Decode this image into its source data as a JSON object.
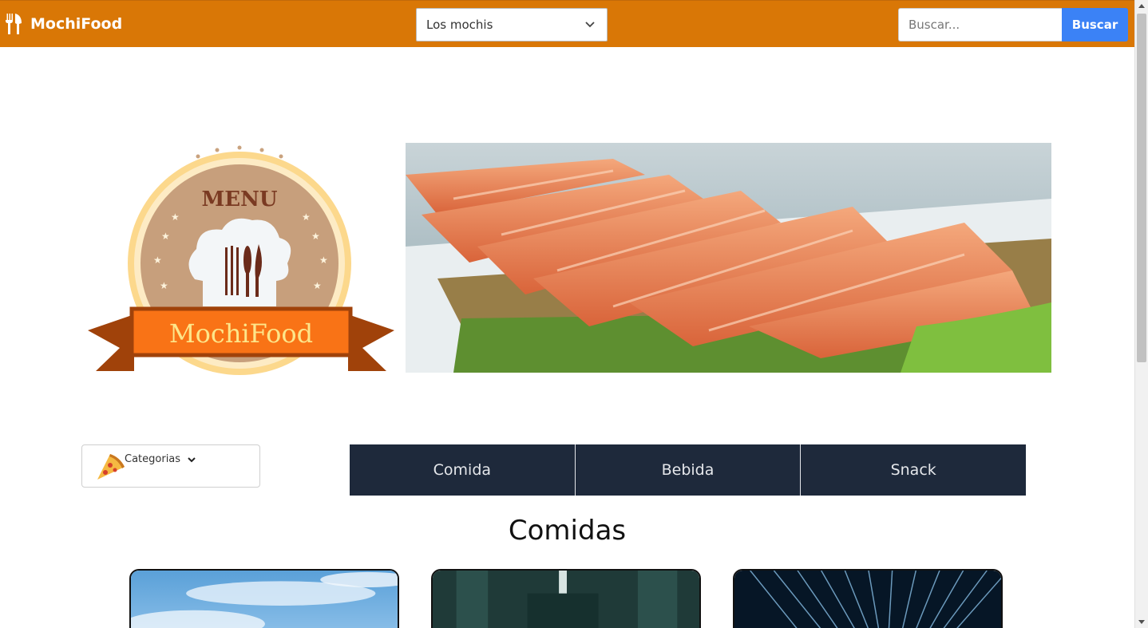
{
  "navbar": {
    "brand": "MochiFood",
    "location": {
      "selected": "Los mochis"
    },
    "search": {
      "placeholder": "Buscar...",
      "button_label": "Buscar"
    }
  },
  "hero": {
    "badge_top_text": "MENU",
    "badge_ribbon_text": "MochiFood"
  },
  "category_dropdown": {
    "label": "Categorias",
    "icon": "pizza-icon"
  },
  "tabs": [
    {
      "label": "Comida"
    },
    {
      "label": "Bebida"
    },
    {
      "label": "Snack"
    }
  ],
  "section_title": "Comidas",
  "colors": {
    "navbar": "#d97706",
    "search_button": "#3b82f6",
    "tabs": "#1e293b",
    "ribbon": "#f97316"
  }
}
